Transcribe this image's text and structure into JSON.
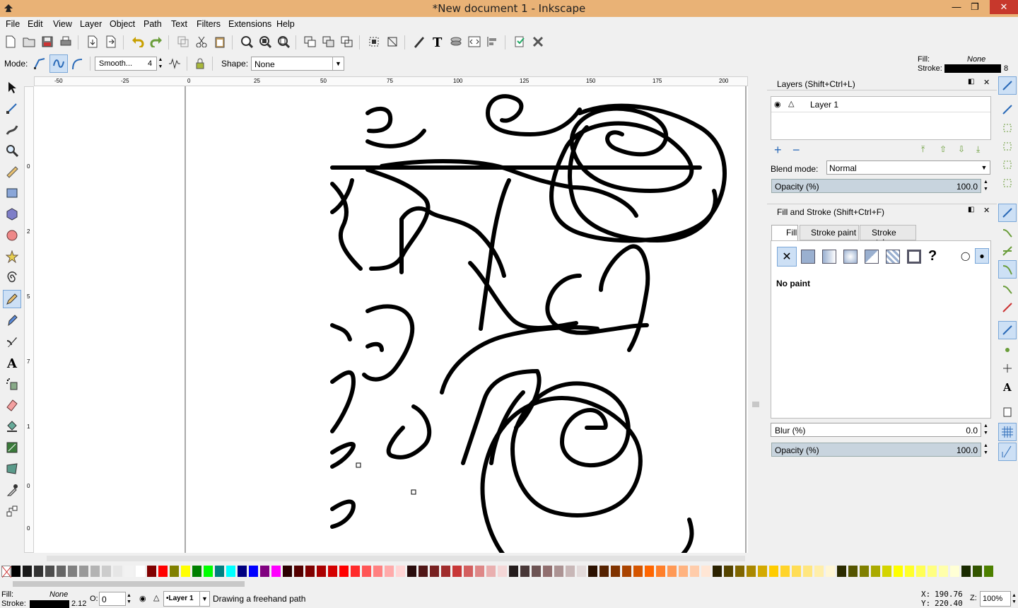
{
  "window": {
    "title": "*New document 1 - Inkscape"
  },
  "menu": [
    "File",
    "Edit",
    "View",
    "Layer",
    "Object",
    "Path",
    "Text",
    "Filters",
    "Extensions",
    "Help"
  ],
  "controls": {
    "mode_label": "Mode:",
    "smoothing_label": "Smooth...",
    "smoothing_value": "4",
    "shape_label": "Shape:",
    "shape_value": "None"
  },
  "style_indicator": {
    "fill_label": "Fill:",
    "fill_value": "None",
    "stroke_label": "Stroke:",
    "stroke_width": "8"
  },
  "ruler_top": {
    "labels": [
      "-50",
      "-25",
      "0",
      "25",
      "50",
      "75",
      "100",
      "125",
      "150",
      "175",
      "200"
    ]
  },
  "ruler_left": {
    "labels": [
      "0",
      "2",
      "5",
      "7",
      "1",
      "0",
      "0"
    ]
  },
  "layers_panel": {
    "title": "Layers (Shift+Ctrl+L)",
    "layers": [
      {
        "name": "Layer 1"
      }
    ],
    "blend_label": "Blend mode:",
    "blend_value": "Normal",
    "opacity_label": "Opacity (%)",
    "opacity_value": "100.0"
  },
  "fill_stroke_panel": {
    "title": "Fill and Stroke (Shift+Ctrl+F)",
    "tabs": [
      "Fill",
      "Stroke paint",
      "Stroke style"
    ],
    "paint_status": "No paint",
    "blur_label": "Blur (%)",
    "blur_value": "0.0",
    "opacity_label": "Opacity (%)",
    "opacity_value": "100.0"
  },
  "status": {
    "fill_label": "Fill:",
    "fill_value": "None",
    "stroke_label": "Stroke:",
    "stroke_width": "2.12",
    "opacity_label": "O:",
    "opacity_value": "0",
    "layer": "•Layer 1",
    "message": "Drawing a freehand path",
    "x_label": "X:",
    "x_value": "190.76",
    "y_label": "Y:",
    "y_value": "220.40",
    "zoom_label": "Z:",
    "zoom_value": "100%"
  },
  "colors": {
    "title_bar": "#e9b276",
    "selection": "#cde0f5"
  },
  "icons": [
    "inkscape-logo-icon",
    "new-document-icon",
    "open-icon",
    "save-icon",
    "print-icon",
    "import-icon",
    "export-icon",
    "undo-icon",
    "redo-icon",
    "pencil-tool-icon",
    "select-tool-icon",
    "zoom-tool-icon"
  ]
}
